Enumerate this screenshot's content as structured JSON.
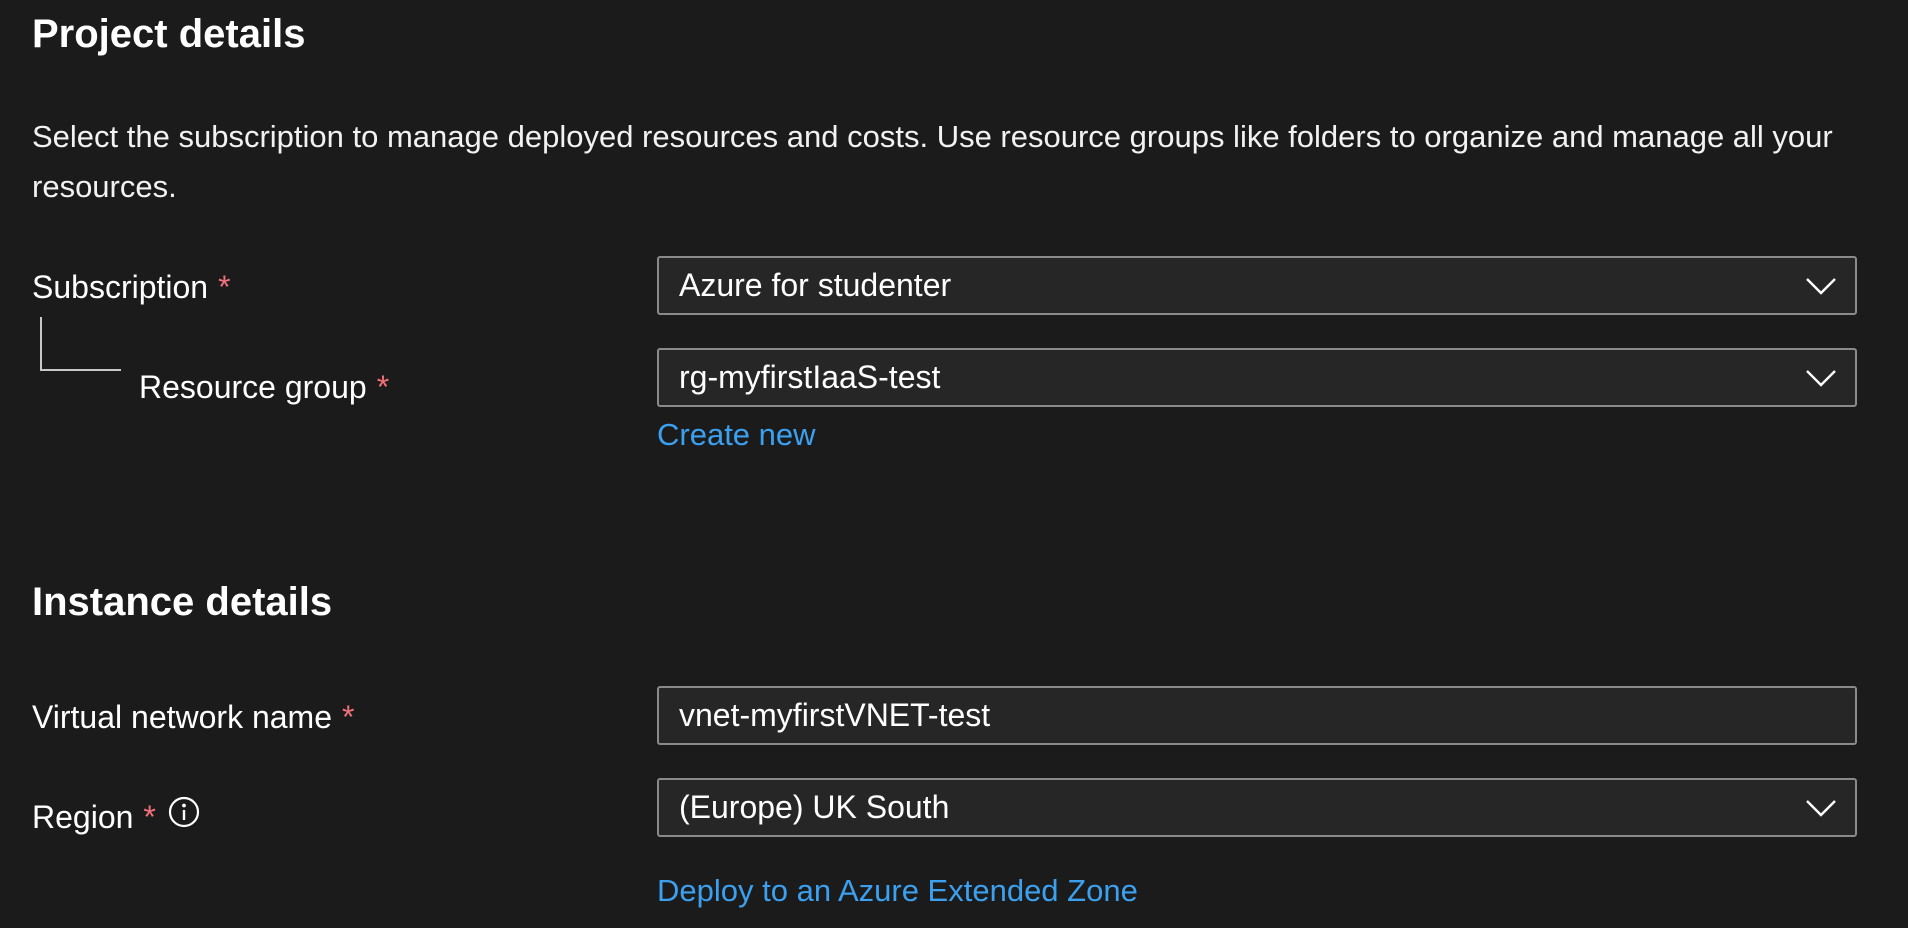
{
  "project_section": {
    "heading": "Project details",
    "description": "Select the subscription to manage deployed resources and costs. Use resource groups like folders to organize and manage all your resources."
  },
  "subscription": {
    "label": "Subscription",
    "required_mark": "*",
    "value": "Azure for studenter",
    "icon": "chevron-down-icon"
  },
  "resource_group": {
    "label": "Resource group",
    "required_mark": "*",
    "value": "rg-myfirstIaaS-test",
    "icon": "chevron-down-icon",
    "create_new_link": "Create new"
  },
  "instance_section": {
    "heading": "Instance details"
  },
  "vnet_name": {
    "label": "Virtual network name",
    "required_mark": "*",
    "value": "vnet-myfirstVNET-test"
  },
  "region": {
    "label": "Region",
    "required_mark": "*",
    "info_icon": "info-icon",
    "value": "(Europe) UK South",
    "icon": "chevron-down-icon",
    "extended_zone_link": "Deploy to an Azure Extended Zone"
  },
  "colors": {
    "background": "#1b1b1b",
    "link": "#3ba0f0",
    "required": "#f1707b",
    "control_border": "#8a8a8a"
  }
}
